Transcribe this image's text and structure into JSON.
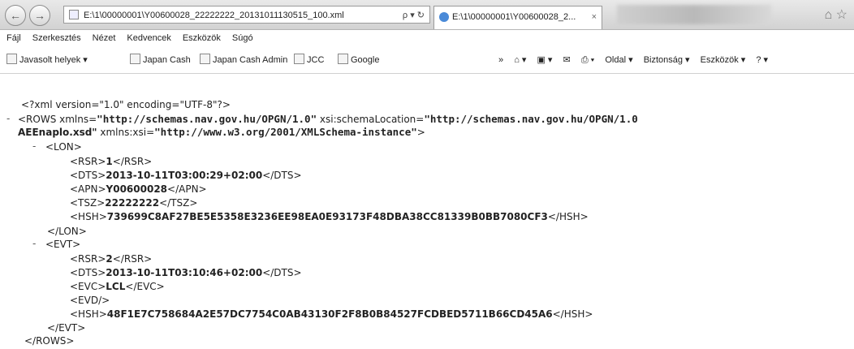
{
  "browser": {
    "address": "E:\\1\\00000001\\Y00600028_22222222_20131011130515_100.xml",
    "address_tools": "ρ ▾ ↻",
    "tab_title": "E:\\1\\00000001\\Y00600028_2...",
    "tab_close": "×",
    "right_icons": "⌂ ☆"
  },
  "menu": [
    "Fájl",
    "Szerkesztés",
    "Nézet",
    "Kedvencek",
    "Eszközök",
    "Súgó"
  ],
  "favorites": [
    {
      "label": "Javasolt helyek ▾"
    },
    {
      "label": "Japan Cash"
    },
    {
      "label": "Japan Cash Admin"
    },
    {
      "label": "JCC"
    },
    {
      "label": "Google"
    }
  ],
  "commands": {
    "overflow": "»",
    "home": "⌂ ▾",
    "feeds": "▣ ▾",
    "mail": "✉",
    "print": "⎙ ▾",
    "page": "Oldal ▾",
    "safety": "Biztonság ▾",
    "tools": "Eszközök ▾",
    "help": "? ▾"
  },
  "xml": {
    "decl": "<?xml version=\"1.0\" encoding=\"UTF-8\"?>",
    "rows_open_a": "<ROWS xmlns=",
    "rows_ns": "\"http://schemas.nav.gov.hu/OPGN/1.0\"",
    "rows_sl_attr": " xsi:schemaLocation=",
    "rows_sl_val1": "\"http://schemas.nav.gov.hu/OPGN/1.0",
    "rows_sl_val2": "AEEnaplo.xsd\"",
    "rows_xsi_attr": " xmlns:xsi=",
    "rows_xsi_val": "\"http://www.w3.org/2001/XMLSchema-instance\"",
    "gt": ">",
    "collapse": "-",
    "lon_open": "<LON>",
    "lon_rsr_o": "<RSR>",
    "lon_rsr_v": "1",
    "lon_rsr_c": "</RSR>",
    "lon_dts_o": "<DTS>",
    "lon_dts_v": "2013-10-11T03:00:29+02:00",
    "lon_dts_c": "</DTS>",
    "lon_apn_o": "<APN>",
    "lon_apn_v": "Y00600028",
    "lon_apn_c": "</APN>",
    "lon_tsz_o": "<TSZ>",
    "lon_tsz_v": "22222222",
    "lon_tsz_c": "</TSZ>",
    "lon_hsh_o": "<HSH>",
    "lon_hsh_v": "739699C8AF27BE5E5358E3236EE98EA0E93173F48DBA38CC81339B0BB7080CF3",
    "lon_hsh_c": "</HSH>",
    "lon_close": "</LON>",
    "evt_open": "<EVT>",
    "evt_rsr_o": "<RSR>",
    "evt_rsr_v": "2",
    "evt_rsr_c": "</RSR>",
    "evt_dts_o": "<DTS>",
    "evt_dts_v": "2013-10-11T03:10:46+02:00",
    "evt_dts_c": "</DTS>",
    "evt_evc_o": "<EVC>",
    "evt_evc_v": "LCL",
    "evt_evc_c": "</EVC>",
    "evt_evd": "<EVD/>",
    "evt_hsh_o": "<HSH>",
    "evt_hsh_v": "48F1E7C758684A2E57DC7754C0AB43130F2F8B0B84527FCDBED5711B66CD45A6",
    "evt_hsh_c": "</HSH>",
    "evt_close": "</EVT>",
    "rows_close": "</ROWS>"
  }
}
